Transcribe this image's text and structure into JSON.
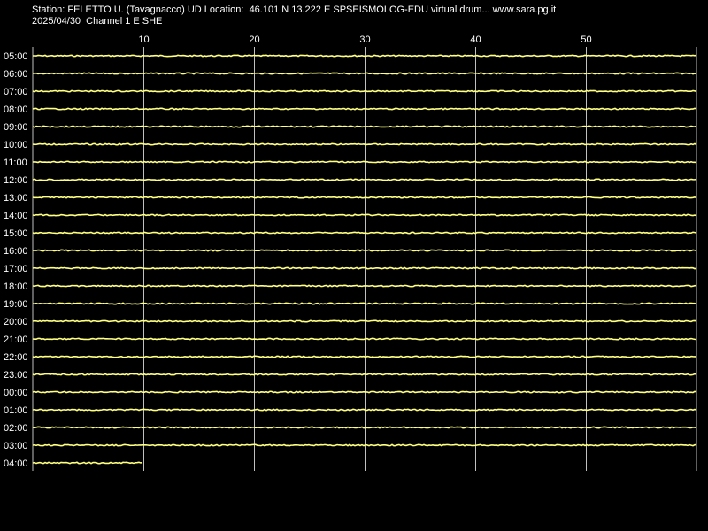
{
  "header": {
    "line1": "Station: FELETTO U. (Tavagnacco) UD Location:  46.101 N 13.222 E SPSEISMOLOG-EDU virtual drum... www.sara.pg.it",
    "line2": "2025/04/30  Channel 1 E SHE"
  },
  "colors": {
    "background": "#000000",
    "grid": "#c0c0c0",
    "trace": "#ffff80",
    "text": "#ffffff"
  },
  "chart_data": {
    "type": "line",
    "title": "",
    "xlabel": "",
    "ylabel": "",
    "xlim": [
      0,
      60
    ],
    "x_ticks": [
      10,
      20,
      30,
      40,
      50
    ],
    "row_labels": [
      "05:00",
      "06:00",
      "07:00",
      "08:00",
      "09:00",
      "10:00",
      "11:00",
      "12:00",
      "13:00",
      "14:00",
      "15:00",
      "16:00",
      "17:00",
      "18:00",
      "19:00",
      "20:00",
      "21:00",
      "22:00",
      "23:00",
      "00:00",
      "01:00",
      "02:00",
      "03:00",
      "04:00"
    ],
    "trace_end_minute": [
      60,
      60,
      60,
      60,
      60,
      60,
      60,
      60,
      60,
      60,
      60,
      60,
      60,
      60,
      60,
      60,
      60,
      60,
      60,
      60,
      60,
      60,
      60,
      10
    ],
    "grid": true
  }
}
